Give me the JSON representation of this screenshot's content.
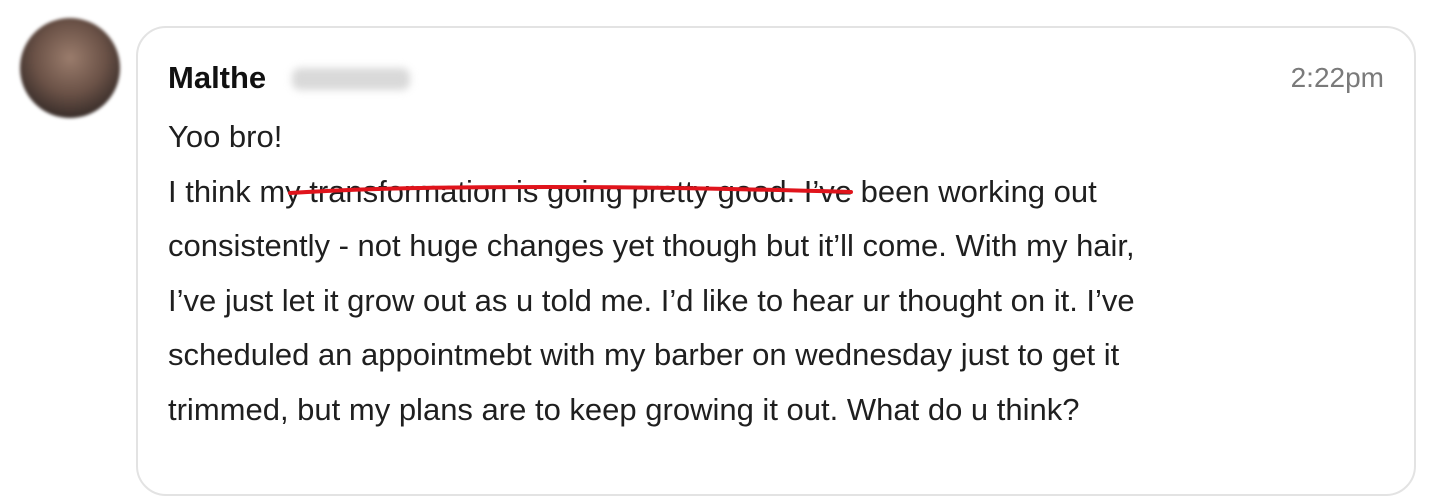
{
  "message": {
    "sender_first_name": "Malthe",
    "timestamp": "2:22pm",
    "lines": [
      "Yoo bro!",
      "I think my transformation is going pretty good. I’ve been working out",
      "consistently - not huge changes yet though but it’ll come. With my hair,",
      "I’ve just let it grow out as u told me. I’d like to hear ur thought on it. I’ve",
      "scheduled an appointmebt with my barber on wednesday just to get it",
      "trimmed, but my plans are to keep growing it out. What do u think?"
    ]
  },
  "colors": {
    "underline": "#e0141c",
    "bubble_border": "#e3e3e3",
    "timestamp": "#7a7a7a"
  },
  "icons": {
    "avatar": "blurred-user-avatar"
  }
}
